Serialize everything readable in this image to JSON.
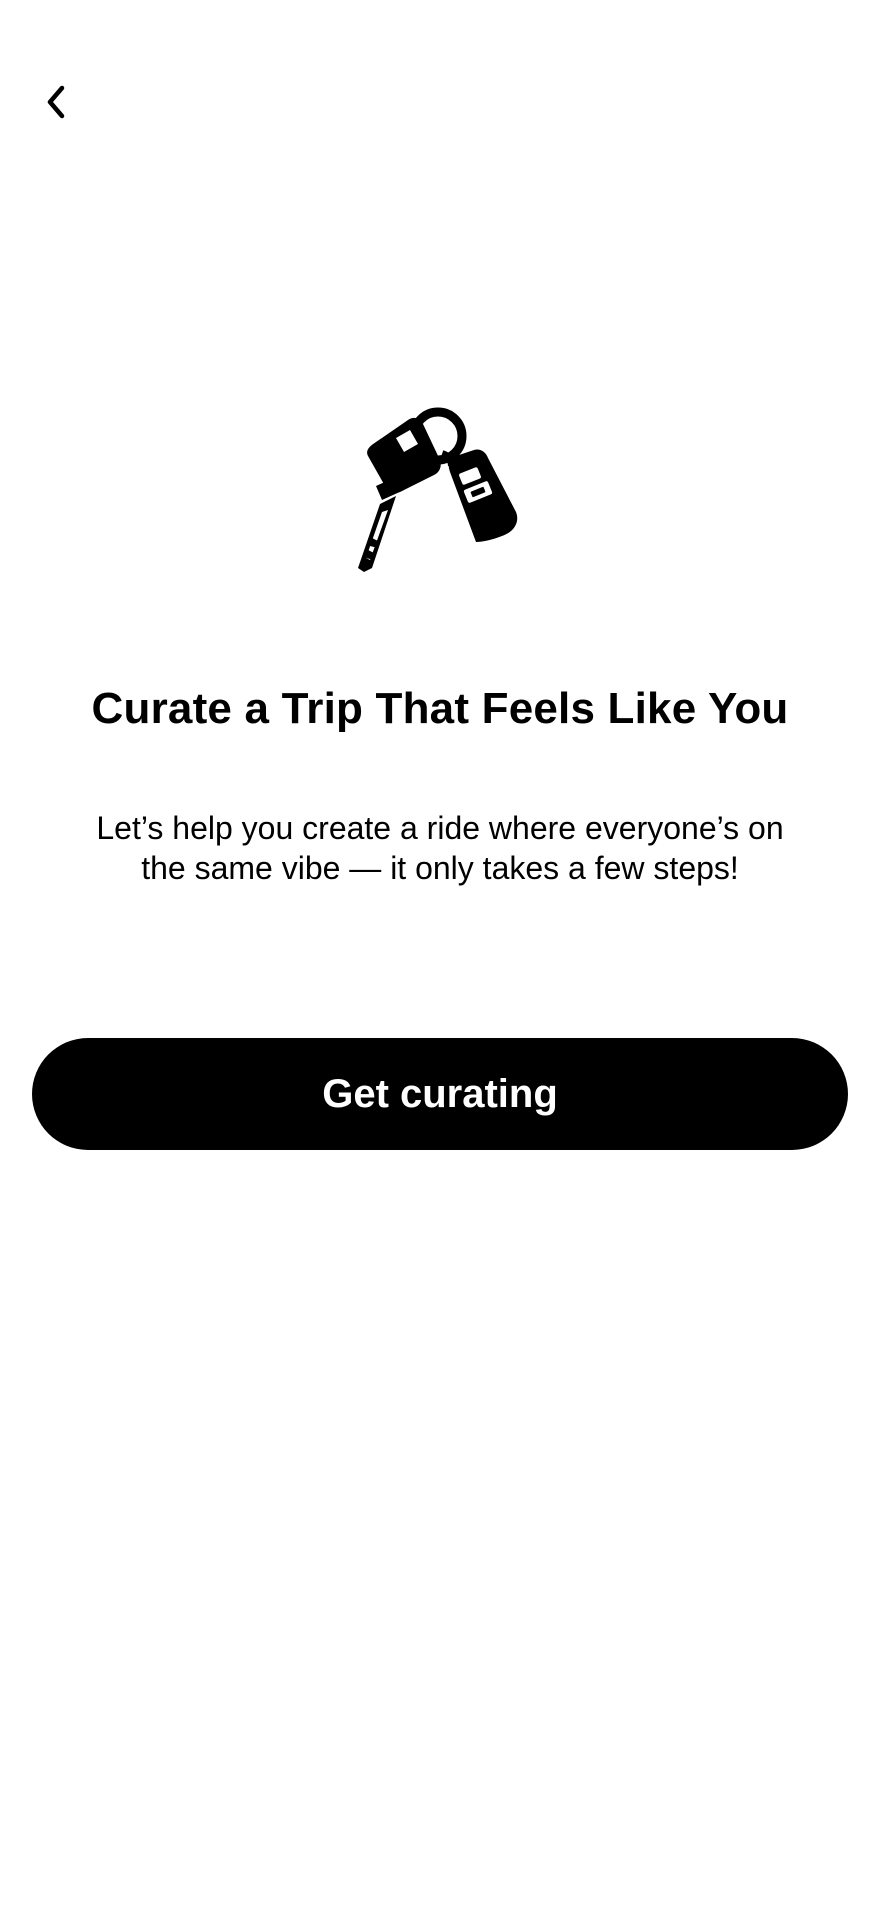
{
  "header": {
    "back_icon": "chevron-left-icon"
  },
  "hero": {
    "icon": "car-keys-icon"
  },
  "content": {
    "title": "Curate a Trip That Feels Like You",
    "subtitle": "Let’s help you create a ride where everyone’s on the same vibe — it only takes a few steps!"
  },
  "actions": {
    "primary_label": "Get curating"
  },
  "colors": {
    "background": "#ffffff",
    "primary": "#000000",
    "on_primary": "#ffffff"
  }
}
